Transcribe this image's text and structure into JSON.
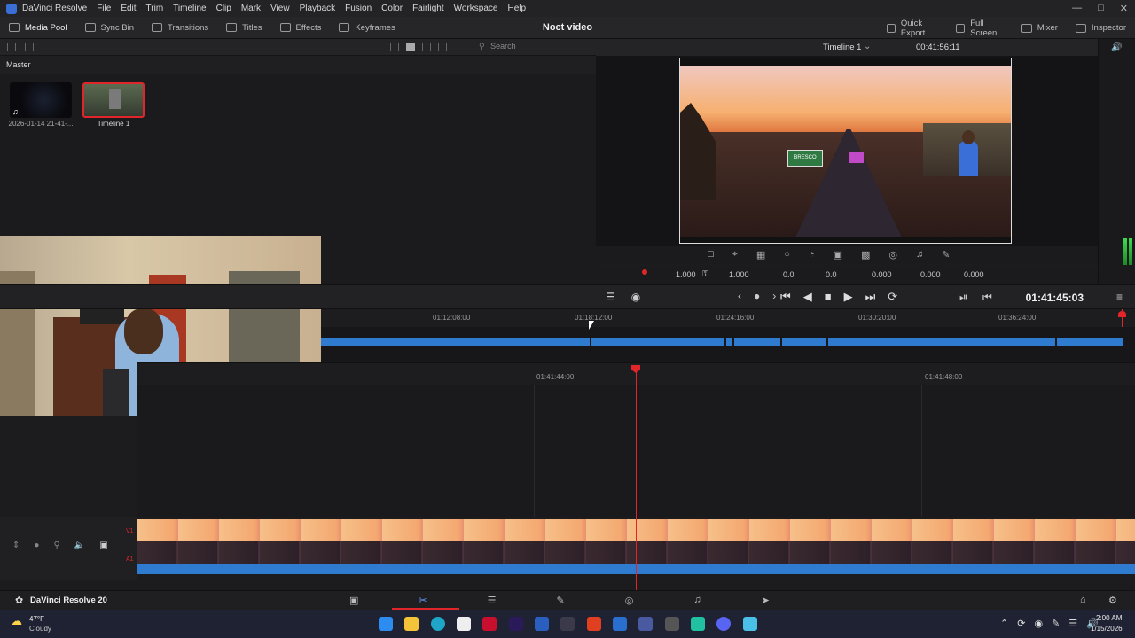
{
  "app": {
    "name": "DaVinci Resolve",
    "menu": [
      "File",
      "Edit",
      "Trim",
      "Timeline",
      "Clip",
      "Mark",
      "View",
      "Playback",
      "Fusion",
      "Color",
      "Fairlight",
      "Workspace",
      "Help"
    ]
  },
  "toolbar": {
    "left": [
      {
        "label": "Media Pool",
        "active": true
      },
      {
        "label": "Sync Bin",
        "active": false
      },
      {
        "label": "Transitions",
        "active": false
      },
      {
        "label": "Titles",
        "active": false
      },
      {
        "label": "Effects",
        "active": false
      },
      {
        "label": "Keyframes",
        "active": false
      }
    ],
    "project_title": "Noct video",
    "right": [
      {
        "label": "Quick Export"
      },
      {
        "label": "Full Screen"
      },
      {
        "label": "Mixer"
      },
      {
        "label": "Inspector"
      }
    ]
  },
  "media_pool": {
    "search_placeholder": "Search",
    "bin": "Master",
    "clips": [
      {
        "label": "2026-01-14 21-41-..."
      },
      {
        "label": "Timeline 1"
      }
    ]
  },
  "viewer": {
    "timeline_name": "Timeline 1",
    "timecode": "00:41:56:11",
    "sign_text": "BRESCO"
  },
  "inspector_values": {
    "zoom_x": "1.000",
    "zoom_y": "1.000",
    "pos_x": "0.0",
    "pos_y": "0.0",
    "rotation": "0.000",
    "anchor_x": "0.000",
    "anchor_y": "0.000"
  },
  "transport": {
    "timecode": "01:41:45:03"
  },
  "upper_ruler": [
    "01:12:08:00",
    "01:18:12:00",
    "01:24:16:00",
    "01:30:20:00",
    "01:36:24:00"
  ],
  "lower_ruler": [
    "01:41:44:00",
    "01:41:48:00"
  ],
  "tracks": {
    "video": "V1",
    "audio": "A1"
  },
  "bottom": {
    "version_label": "DaVinci Resolve 20"
  },
  "taskbar": {
    "weather_temp": "47°F",
    "weather_desc": "Cloudy",
    "time": "2:00 AM",
    "date": "1/15/2026"
  },
  "colors": {
    "accent_red": "#e0262a",
    "clip_blue": "#2f7bd0",
    "panel_bg": "#1c1c1e"
  }
}
